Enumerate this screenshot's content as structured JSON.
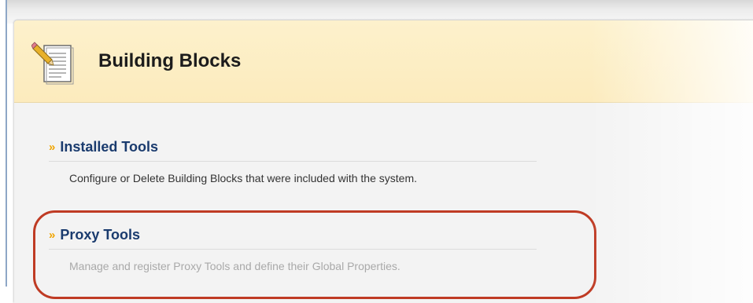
{
  "page": {
    "title": "Building Blocks"
  },
  "tools": [
    {
      "title": "Installed Tools",
      "description": "Configure or Delete Building Blocks that were included with the system."
    },
    {
      "title": "Proxy Tools",
      "description": "Manage and register Proxy Tools and define their Global Properties."
    }
  ],
  "icons": {
    "page_icon": "document-pencil-icon",
    "link_icon": "chevron-double-right-icon"
  },
  "colors": {
    "header_bg": "#fcebbd",
    "link": "#1a3b6e",
    "chevron": "#f0a400",
    "highlight": "#bf3b24"
  }
}
